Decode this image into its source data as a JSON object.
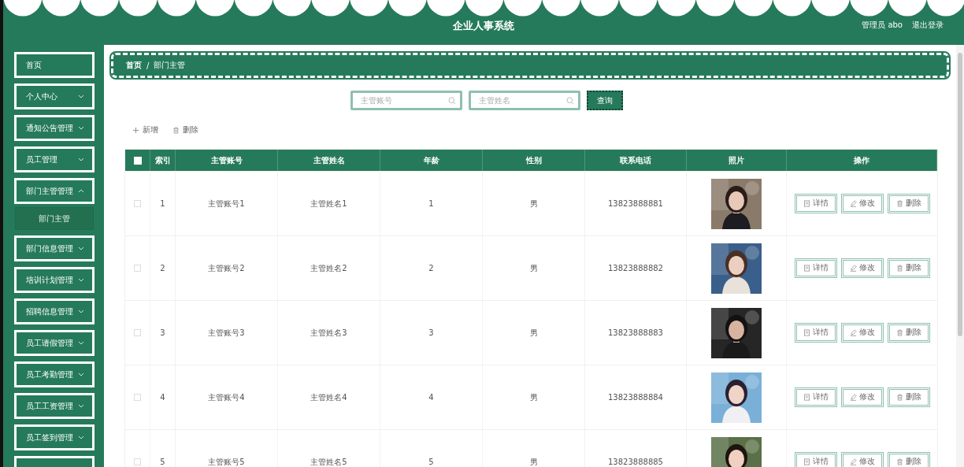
{
  "header": {
    "title": "企业人事系统",
    "user": "管理员 abo",
    "logout": "退出登录"
  },
  "sidebar": {
    "items": [
      {
        "label": "首页",
        "expandable": false
      },
      {
        "label": "个人中心",
        "expandable": true,
        "expanded": false
      },
      {
        "label": "通知公告管理",
        "expandable": true,
        "expanded": false
      },
      {
        "label": "员工管理",
        "expandable": true,
        "expanded": false
      },
      {
        "label": "部门主管管理",
        "expandable": true,
        "expanded": true,
        "children": [
          {
            "label": "部门主管",
            "selected": true
          }
        ]
      },
      {
        "label": "部门信息管理",
        "expandable": true,
        "expanded": false
      },
      {
        "label": "培训计划管理",
        "expandable": true,
        "expanded": false
      },
      {
        "label": "招聘信息管理",
        "expandable": true,
        "expanded": false
      },
      {
        "label": "员工请假管理",
        "expandable": true,
        "expanded": false
      },
      {
        "label": "员工考勤管理",
        "expandable": true,
        "expanded": false
      },
      {
        "label": "员工工资管理",
        "expandable": true,
        "expanded": false
      },
      {
        "label": "员工签到管理",
        "expandable": true,
        "expanded": false
      }
    ]
  },
  "breadcrumb": {
    "items": [
      "首页",
      "部门主管"
    ],
    "separator": "/"
  },
  "search": {
    "fields": [
      {
        "placeholder": "主管账号"
      },
      {
        "placeholder": "主管姓名"
      }
    ],
    "button": "查询"
  },
  "toolbar": [
    {
      "kind": "add",
      "label": "新增"
    },
    {
      "kind": "delete",
      "label": "删除"
    }
  ],
  "table": {
    "all_checked": false,
    "columns": [
      "索引",
      "主管账号",
      "主管姓名",
      "年龄",
      "性别",
      "联系电话",
      "照片",
      "操作"
    ],
    "rows": [
      {
        "checked": false,
        "index": "1",
        "account": "主管账号1",
        "name": "主管姓名1",
        "age": "1",
        "gender": "男",
        "phone": "13823888881",
        "actions": [
          "详情",
          "修改",
          "删除"
        ]
      },
      {
        "checked": false,
        "index": "2",
        "account": "主管账号2",
        "name": "主管姓名2",
        "age": "2",
        "gender": "男",
        "phone": "13823888882",
        "actions": [
          "详情",
          "修改",
          "删除"
        ]
      },
      {
        "checked": false,
        "index": "3",
        "account": "主管账号3",
        "name": "主管姓名3",
        "age": "3",
        "gender": "男",
        "phone": "13823888883",
        "actions": [
          "详情",
          "修改",
          "删除"
        ]
      },
      {
        "checked": false,
        "index": "4",
        "account": "主管账号4",
        "name": "主管姓名4",
        "age": "4",
        "gender": "男",
        "phone": "13823888884",
        "actions": [
          "详情",
          "修改",
          "删除"
        ]
      },
      {
        "checked": false,
        "index": "5",
        "account": "主管账号5",
        "name": "主管姓名5",
        "age": "5",
        "gender": "男",
        "phone": "13823888885",
        "actions": [
          "详情",
          "修改",
          "删除"
        ]
      }
    ]
  }
}
